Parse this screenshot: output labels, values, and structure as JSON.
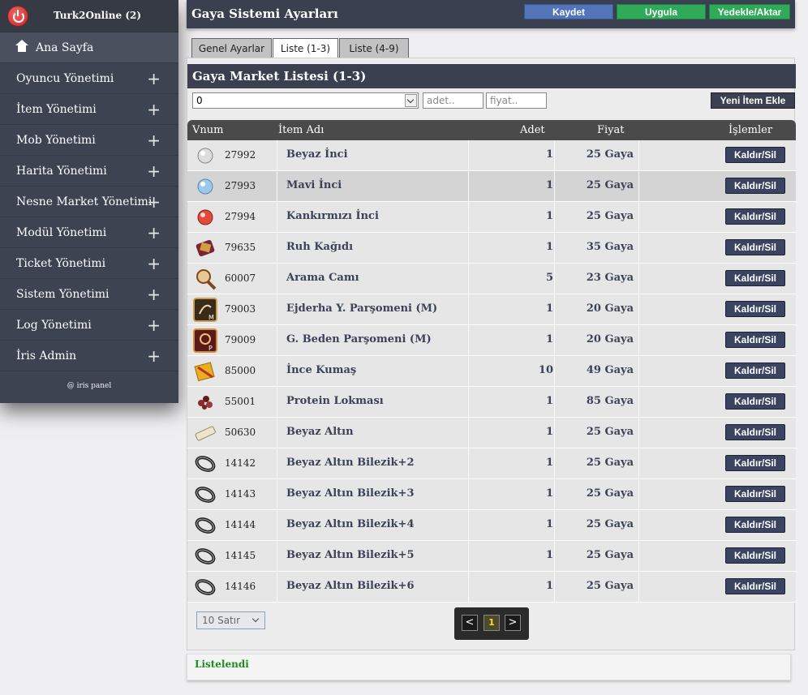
{
  "sidebar": {
    "title": "Turk2Online (2)",
    "home": "Ana Sayfa",
    "items": [
      "Oyuncu Yönetimi",
      "İtem Yönetimi",
      "Mob Yönetimi",
      "Harita Yönetimi",
      "Nesne Market Yönetimi",
      "Modül Yönetimi",
      "Ticket Yönetimi",
      "Sistem Yönetimi",
      "Log Yönetimi",
      "İris Admin"
    ],
    "footer": "@ iris panel"
  },
  "header": {
    "title": "Gaya Sistemi Ayarları",
    "save": "Kaydet",
    "apply": "Uygula",
    "backup": "Yedekle/Aktar"
  },
  "tabs": [
    "Genel Ayarlar",
    "Liste (1-3)",
    "Liste (4-9)"
  ],
  "panel": {
    "title": "Gaya Market Listesi (1-3)",
    "select_value": "0",
    "adet_placeholder": "adet..",
    "fiyat_placeholder": "fiyat..",
    "new_item": "Yeni İtem Ekle"
  },
  "table": {
    "columns": [
      "Vnum",
      "İtem Adı",
      "Adet",
      "Fiyat",
      "İşlemler"
    ],
    "delete_label": "Kaldır/Sil",
    "rows": [
      {
        "vnum": "27992",
        "name": "Beyaz İnci",
        "adet": "1",
        "fiyat": "25 Gaya",
        "icon": "white-pearl-icon"
      },
      {
        "vnum": "27993",
        "name": "Mavi İnci",
        "adet": "1",
        "fiyat": "25 Gaya",
        "icon": "blue-pearl-icon"
      },
      {
        "vnum": "27994",
        "name": "Kankırmızı İnci",
        "adet": "1",
        "fiyat": "25 Gaya",
        "icon": "red-pearl-icon"
      },
      {
        "vnum": "79635",
        "name": "Ruh Kağıdı",
        "adet": "1",
        "fiyat": "35 Gaya",
        "icon": "soul-paper-icon"
      },
      {
        "vnum": "60007",
        "name": "Arama Camı",
        "adet": "5",
        "fiyat": "23 Gaya",
        "icon": "magnifier-icon"
      },
      {
        "vnum": "79003",
        "name": "Ejderha Y. Parşomeni (M)",
        "adet": "1",
        "fiyat": "20 Gaya",
        "icon": "dragon-scroll-icon"
      },
      {
        "vnum": "79009",
        "name": "G. Beden Parşomeni (M)",
        "adet": "1",
        "fiyat": "20 Gaya",
        "icon": "body-scroll-icon"
      },
      {
        "vnum": "85000",
        "name": "İnce Kumaş",
        "adet": "10",
        "fiyat": "49 Gaya",
        "icon": "cloth-icon"
      },
      {
        "vnum": "55001",
        "name": "Protein Lokması",
        "adet": "1",
        "fiyat": "85 Gaya",
        "icon": "protein-icon"
      },
      {
        "vnum": "50630",
        "name": "Beyaz Altın",
        "adet": "1",
        "fiyat": "25 Gaya",
        "icon": "white-gold-icon"
      },
      {
        "vnum": "14142",
        "name": "Beyaz Altın Bilezik+2",
        "adet": "1",
        "fiyat": "25 Gaya",
        "icon": "bracelet-icon"
      },
      {
        "vnum": "14143",
        "name": "Beyaz Altın Bilezik+3",
        "adet": "1",
        "fiyat": "25 Gaya",
        "icon": "bracelet-icon"
      },
      {
        "vnum": "14144",
        "name": "Beyaz Altın Bilezik+4",
        "adet": "1",
        "fiyat": "25 Gaya",
        "icon": "bracelet-icon"
      },
      {
        "vnum": "14145",
        "name": "Beyaz Altın Bilezik+5",
        "adet": "1",
        "fiyat": "25 Gaya",
        "icon": "bracelet-icon"
      },
      {
        "vnum": "14146",
        "name": "Beyaz Altın Bilezik+6",
        "adet": "1",
        "fiyat": "25 Gaya",
        "icon": "bracelet-icon"
      }
    ]
  },
  "footer": {
    "rows_select": "10 Satır",
    "prev": "<",
    "page": "1",
    "next": ">",
    "status": "Listelendi"
  }
}
